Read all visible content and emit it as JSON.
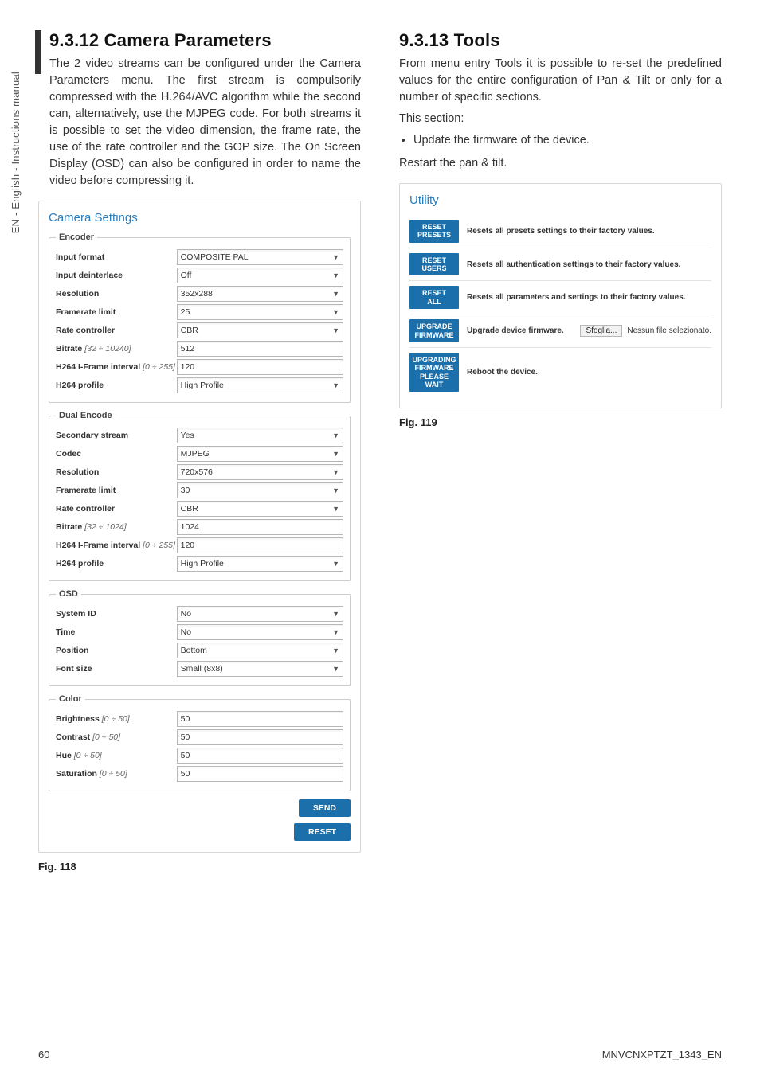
{
  "sidebar": "EN - English - Instructions manual",
  "left": {
    "heading": "9.3.12 Camera Parameters",
    "para": "The 2 video streams can be configured under the Camera Parameters menu. The first stream is compulsorily compressed with the H.264/AVC algorithm while the second can, alternatively, use the MJPEG code. For both streams it is possible to set the video dimension, the frame rate, the use of the rate controller and the GOP size. The On Screen Display (OSD) can also be configured in order to name the video before compressing it.",
    "figcap": "Fig. 118",
    "panel_title": "Camera Settings",
    "legend_encoder": "Encoder",
    "legend_dual": "Dual Encode",
    "legend_osd": "OSD",
    "legend_color": "Color",
    "encoder": [
      {
        "label": "Input format",
        "value": "COMPOSITE PAL",
        "select": true
      },
      {
        "label": "Input deinterlace",
        "value": "Off",
        "select": true
      },
      {
        "label": "Resolution",
        "value": "352x288",
        "select": true
      },
      {
        "label": "Framerate limit",
        "value": "25",
        "select": true
      },
      {
        "label": "Rate controller",
        "value": "CBR",
        "select": true
      },
      {
        "label": "Bitrate",
        "hint": "[32 ÷ 10240]",
        "value": "512",
        "select": false
      },
      {
        "label": "H264 I-Frame interval",
        "hint": "[0 ÷ 255]",
        "value": "120",
        "select": false
      },
      {
        "label": "H264 profile",
        "value": "High Profile",
        "select": true
      }
    ],
    "dual": [
      {
        "label": "Secondary stream",
        "value": "Yes",
        "select": true
      },
      {
        "label": "Codec",
        "value": "MJPEG",
        "select": true
      },
      {
        "label": "Resolution",
        "value": "720x576",
        "select": true
      },
      {
        "label": "Framerate limit",
        "value": "30",
        "select": true
      },
      {
        "label": "Rate controller",
        "value": "CBR",
        "select": true
      },
      {
        "label": "Bitrate",
        "hint": "[32 ÷ 1024]",
        "value": "1024",
        "select": false
      },
      {
        "label": "H264 I-Frame interval",
        "hint": "[0 ÷ 255]",
        "value": "120",
        "select": false
      },
      {
        "label": "H264 profile",
        "value": "High Profile",
        "select": true
      }
    ],
    "osd": [
      {
        "label": "System ID",
        "value": "No",
        "select": true
      },
      {
        "label": "Time",
        "value": "No",
        "select": true
      },
      {
        "label": "Position",
        "value": "Bottom",
        "select": true
      },
      {
        "label": "Font size",
        "value": "Small (8x8)",
        "select": true
      }
    ],
    "color": [
      {
        "label": "Brightness",
        "hint": "[0 ÷ 50]",
        "value": "50",
        "select": false
      },
      {
        "label": "Contrast",
        "hint": "[0 ÷ 50]",
        "value": "50",
        "select": false
      },
      {
        "label": "Hue",
        "hint": "[0 ÷ 50]",
        "value": "50",
        "select": false
      },
      {
        "label": "Saturation",
        "hint": "[0 ÷ 50]",
        "value": "50",
        "select": false
      }
    ],
    "btn_send": "SEND",
    "btn_reset": "RESET"
  },
  "right": {
    "heading": "9.3.13 Tools",
    "para1": "From menu entry Tools  it is possible to re-set the predefined values for the entire configuration of Pan & Tilt or only for a number of specific sections.",
    "para2": "This section:",
    "bullet1": "Update the firmware of the device.",
    "para3": "Restart the pan & tilt.",
    "figcap": "Fig. 119",
    "panel_title": "Utility",
    "rows": [
      {
        "btn": "RESET PRESETS",
        "desc": "Resets all presets settings to their factory values."
      },
      {
        "btn": "RESET USERS",
        "desc": "Resets all authentication settings to their factory values."
      },
      {
        "btn": "RESET ALL",
        "desc": "Resets all parameters and settings to their factory values."
      },
      {
        "btn": "UPGRADE FIRMWARE",
        "desc": "Upgrade device firmware.",
        "browse": true,
        "browse_btn": "Sfoglia...",
        "browse_text": "Nessun file selezionato."
      },
      {
        "btn": "UPGRADING FIRMWARE PLEASE WAIT",
        "desc": "Reboot the device."
      }
    ]
  },
  "footer": {
    "page": "60",
    "doc": "MNVCNXPTZT_1343_EN"
  }
}
